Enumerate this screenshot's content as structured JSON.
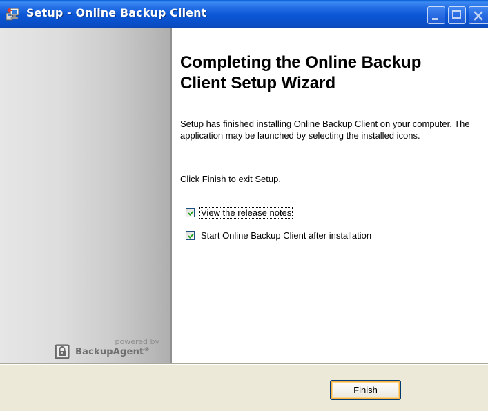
{
  "window": {
    "title": "Setup - Online Backup Client",
    "icon": "setup-installer-icon",
    "controls": [
      "minimize-icon",
      "maximize-icon",
      "close-icon"
    ]
  },
  "sidebar": {
    "powered_by": "powered by",
    "brand_name": "BackupAgent",
    "brand_reg": "®",
    "brand_icon": "lock-icon"
  },
  "wizard": {
    "heading": "Completing the Online Backup Client Setup Wizard",
    "finished_text": "Setup has finished installing Online Backup Client on your computer. The application may be launched by selecting the installed icons.",
    "exit_text": "Click Finish to exit Setup.",
    "options": [
      {
        "label": "View the release notes",
        "checked": true
      },
      {
        "label": "Start Online Backup Client after installation",
        "checked": true
      }
    ]
  },
  "buttons": {
    "finish_mnemonic": "F",
    "finish_rest": "inish"
  },
  "colors": {
    "titlebar": "#0b56d6",
    "panel": "#ece9d8",
    "checkmark": "#21a121"
  }
}
